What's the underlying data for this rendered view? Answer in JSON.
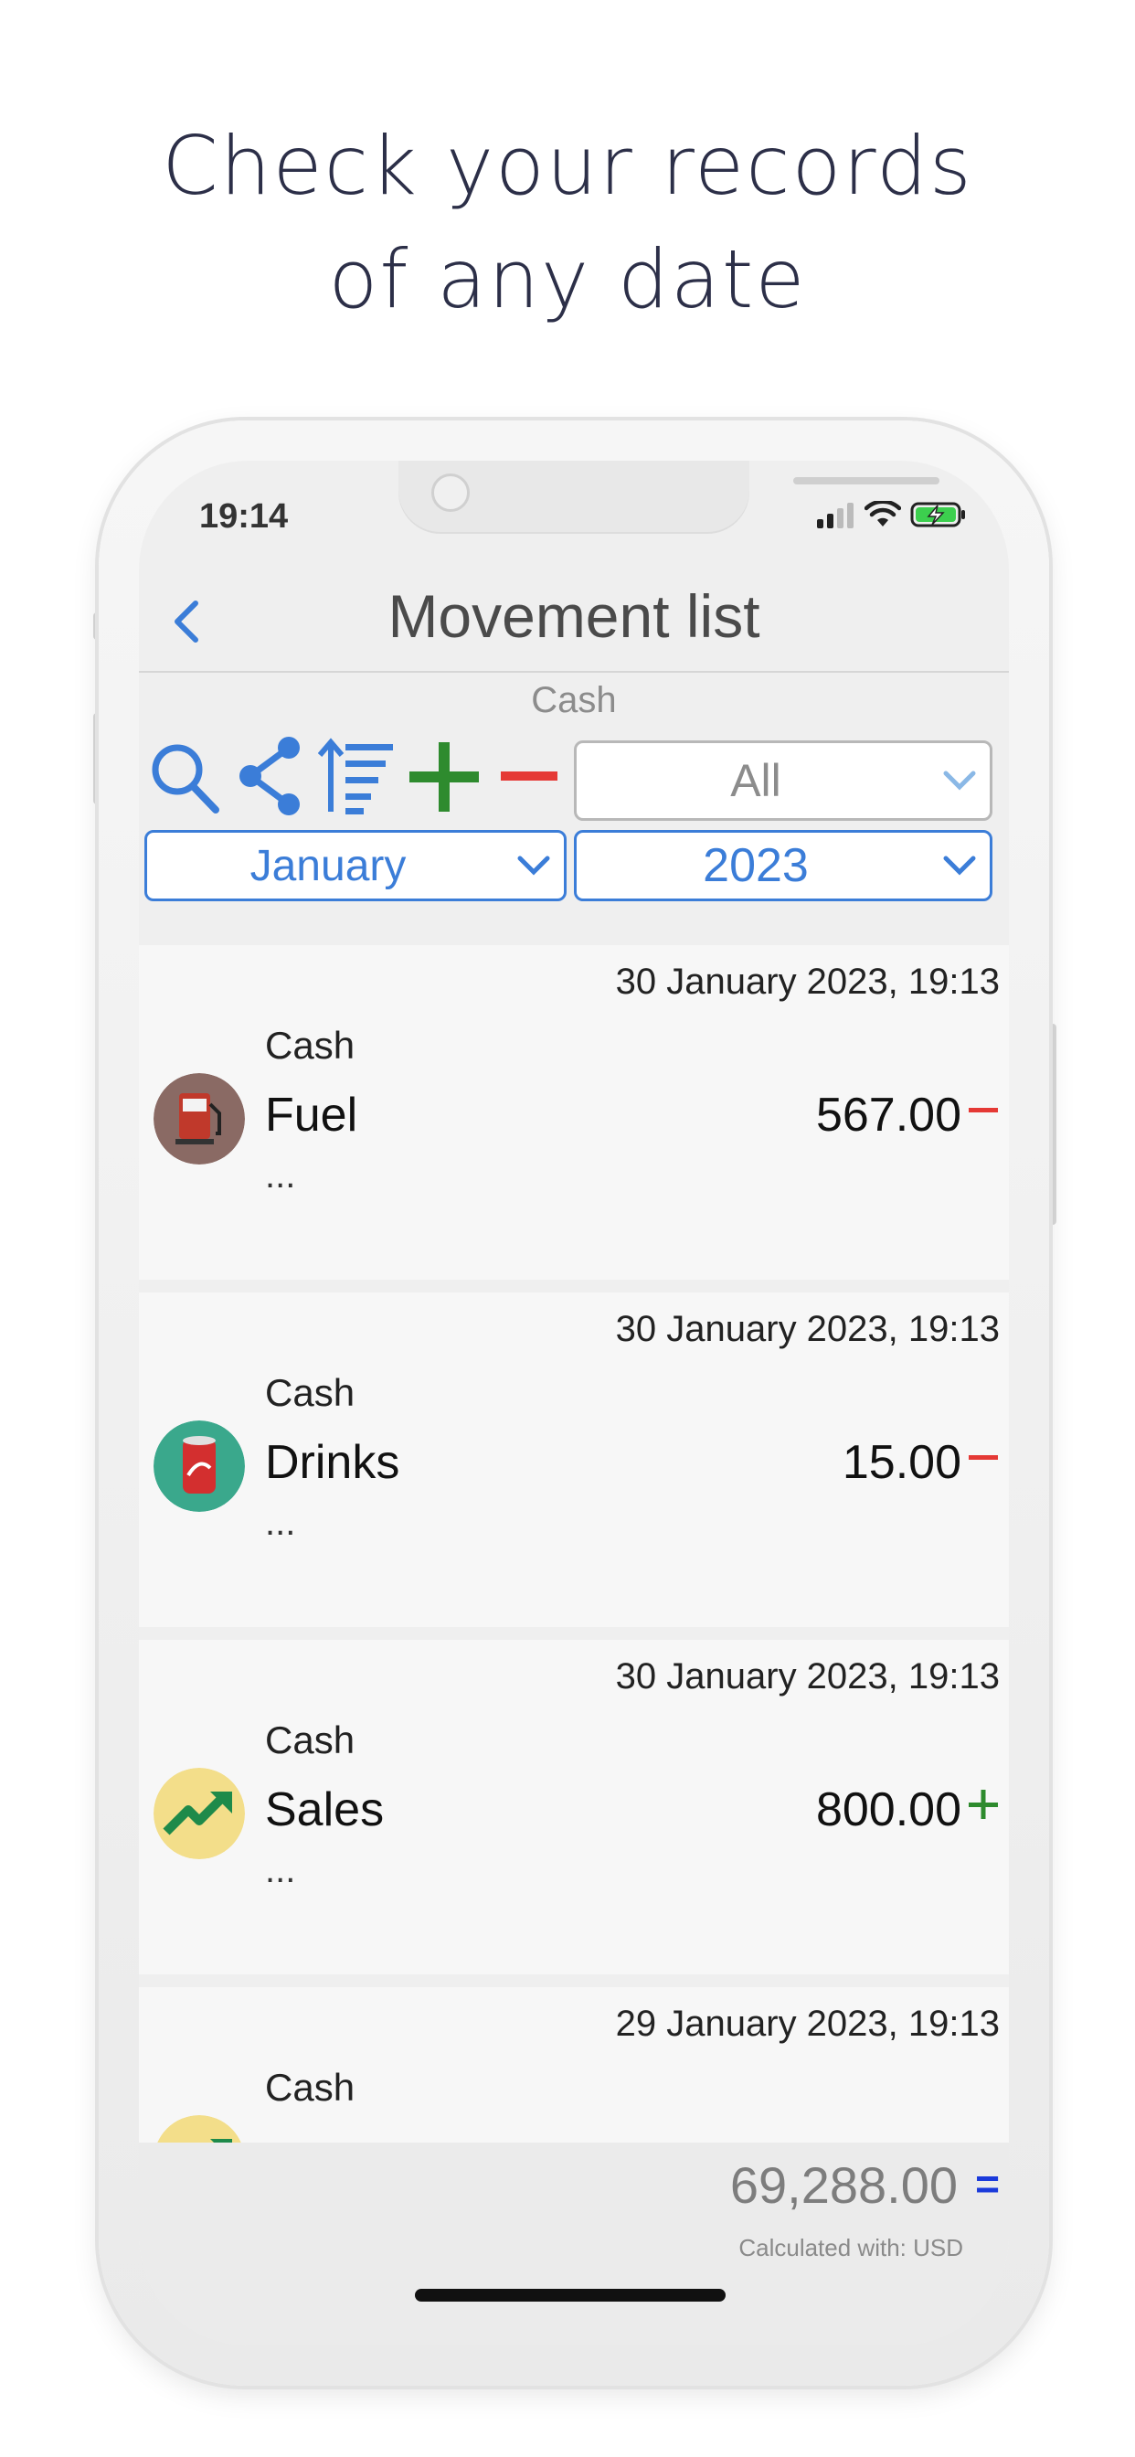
{
  "headline": {
    "line1": "Check your records",
    "line2": "of any date"
  },
  "status_bar": {
    "time": "19:14",
    "icons": [
      "signal-icon",
      "wifi-icon",
      "battery-charging-icon"
    ]
  },
  "nav": {
    "back_icon": "chevron-left-icon",
    "title": "Movement list"
  },
  "account": "Cash",
  "toolbar": {
    "icons": [
      "search-icon",
      "share-icon",
      "sort-icon",
      "add-icon",
      "subtract-icon"
    ],
    "filter_value": "All",
    "month": "January",
    "year": "2023"
  },
  "movements": [
    {
      "date": "30 January 2023, 19:13",
      "account": "Cash",
      "category": "Fuel",
      "note": "...",
      "amount": "567.00",
      "sign": "minus",
      "icon": "fuel-pump-icon"
    },
    {
      "date": "30 January 2023, 19:13",
      "account": "Cash",
      "category": "Drinks",
      "note": "...",
      "amount": "15.00",
      "sign": "minus",
      "icon": "soda-can-icon"
    },
    {
      "date": "30 January 2023, 19:13",
      "account": "Cash",
      "category": "Sales",
      "note": "...",
      "amount": "800.00",
      "sign": "plus",
      "icon": "trend-up-icon"
    },
    {
      "date": "29 January 2023, 19:13",
      "account": "Cash",
      "category": "",
      "note": "",
      "amount": "",
      "sign": "",
      "icon": "trend-up-icon"
    }
  ],
  "footer": {
    "total": "69,288.00",
    "total_sign": "=",
    "calculated_with": "Calculated with: USD"
  },
  "colors": {
    "accent_blue": "#3b7dd8",
    "minus_red": "#e53935",
    "plus_green": "#2e8b2e",
    "headline": "#2c2f48"
  }
}
